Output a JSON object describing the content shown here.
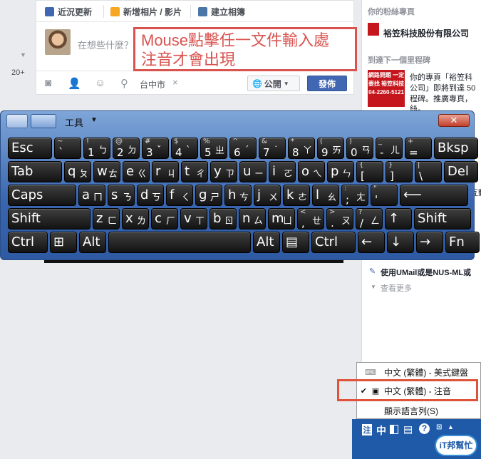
{
  "left_nav": {
    "chevron": "chevron-down-icon",
    "count": "20+"
  },
  "composer": {
    "tabs": [
      "近況更新",
      "新增相片 / 影片",
      "建立相簿"
    ],
    "placeholder": "在想些什麼？",
    "location": "台中市",
    "location_clear": "×",
    "privacy": "公開",
    "post": "發佈"
  },
  "annotation_top": {
    "line1": "Mouse點擊任一文件輸入處",
    "line2": "注音才會出現",
    "color": "#d9534f"
  },
  "sidebar": {
    "title_pages": "你的粉絲專頁",
    "page_name": "裕笠科技股份有限公司",
    "badge1": "網路問題 一定要找 裕笠科技",
    "title_milestone": "到達下一個里程碑",
    "badge2": "網路問題 一定要找 裕笠科技 04-2260-5121",
    "milestone_text1": "你的專頁「裕笠科",
    "milestone_text2": "公司」即將到達 50",
    "milestone_text3": "程碑。推廣專頁，",
    "milestone_text4": "絲。",
    "side_partial": "互動",
    "umail": "使用UMail或是NUS-ML或",
    "see_more": "查看更多"
  },
  "osk": {
    "tools": "工具",
    "close": "✕",
    "rows": [
      [
        {
          "main": "Esc"
        },
        {
          "shift": "~",
          "main": "`"
        },
        {
          "shift": "!",
          "main": "1",
          "bop": "ㄅ"
        },
        {
          "shift": "@",
          "main": "2",
          "bop": "ㄉ"
        },
        {
          "shift": "#",
          "main": "3",
          "bop": "ˇ"
        },
        {
          "shift": "$",
          "main": "4",
          "bop": "ˋ"
        },
        {
          "shift": "%",
          "main": "5",
          "bop": "ㄓ"
        },
        {
          "shift": "^",
          "main": "6",
          "bop": "ˊ"
        },
        {
          "shift": "&",
          "main": "7",
          "bop": "˙"
        },
        {
          "shift": "*",
          "main": "8",
          "bop": "ㄚ"
        },
        {
          "shift": "(",
          "main": "9",
          "bop": "ㄞ"
        },
        {
          "shift": ")",
          "main": "0",
          "bop": "ㄢ"
        },
        {
          "shift": "_",
          "main": "-",
          "bop": "ㄦ"
        },
        {
          "shift": "+",
          "main": "="
        },
        {
          "main": "Bksp"
        }
      ],
      [
        {
          "main": "Tab"
        },
        {
          "main": "q",
          "bop": "ㄆ"
        },
        {
          "main": "w",
          "bop": "ㄊ"
        },
        {
          "main": "e",
          "bop": "ㄍ"
        },
        {
          "main": "r",
          "bop": "ㄐ"
        },
        {
          "main": "t",
          "bop": "ㄔ"
        },
        {
          "main": "y",
          "bop": "ㄗ"
        },
        {
          "main": "u",
          "bop": "ㄧ"
        },
        {
          "main": "i",
          "bop": "ㄛ"
        },
        {
          "main": "o",
          "bop": "ㄟ"
        },
        {
          "main": "p",
          "bop": "ㄣ"
        },
        {
          "shift": "{",
          "main": "["
        },
        {
          "shift": "}",
          "main": "]"
        },
        {
          "shift": "|",
          "main": "\\"
        },
        {
          "main": "Del"
        }
      ],
      [
        {
          "main": "Caps"
        },
        {
          "main": "a",
          "bop": "ㄇ"
        },
        {
          "main": "s",
          "bop": "ㄋ"
        },
        {
          "main": "d",
          "bop": "ㄎ"
        },
        {
          "main": "f",
          "bop": "ㄑ"
        },
        {
          "main": "g",
          "bop": "ㄕ"
        },
        {
          "main": "h",
          "bop": "ㄘ"
        },
        {
          "main": "j",
          "bop": "ㄨ"
        },
        {
          "main": "k",
          "bop": "ㄜ"
        },
        {
          "main": "l",
          "bop": "ㄠ"
        },
        {
          "shift": ":",
          "main": ";",
          "bop": "ㄤ"
        },
        {
          "shift": "\"",
          "main": "'"
        },
        {
          "main": "⟵"
        }
      ],
      [
        {
          "main": "Shift"
        },
        {
          "main": "z",
          "bop": "ㄈ"
        },
        {
          "main": "x",
          "bop": "ㄌ"
        },
        {
          "main": "c",
          "bop": "ㄏ"
        },
        {
          "main": "v",
          "bop": "ㄒ"
        },
        {
          "main": "b",
          "bop": "ㄖ"
        },
        {
          "main": "n",
          "bop": "ㄙ"
        },
        {
          "main": "m",
          "bop": "ㄩ"
        },
        {
          "shift": "<",
          "main": ",",
          "bop": "ㄝ"
        },
        {
          "shift": ">",
          "main": ".",
          "bop": "ㄡ"
        },
        {
          "shift": "?",
          "main": "/",
          "bop": "ㄥ"
        },
        {
          "main": "↑"
        },
        {
          "main": "Shift"
        }
      ],
      [
        {
          "main": "Ctrl"
        },
        {
          "main": "⊞"
        },
        {
          "main": "Alt"
        },
        {
          "main": ""
        },
        {
          "main": "Alt"
        },
        {
          "main": "▤"
        },
        {
          "main": "Ctrl"
        },
        {
          "main": "←"
        },
        {
          "main": "↓"
        },
        {
          "main": "→"
        },
        {
          "main": "Fn"
        }
      ]
    ]
  },
  "ime_menu": {
    "items": [
      "中文 (繁體) - 美式鍵盤",
      "中文 (繁體) - 注音",
      "顯示語言列(S)"
    ],
    "checked": "✔",
    "highlight_color": "#e0533b"
  },
  "langbar": {
    "ime_icon": "注",
    "mode": "中",
    "help": "?"
  },
  "watermark": "iT邦幫忙"
}
